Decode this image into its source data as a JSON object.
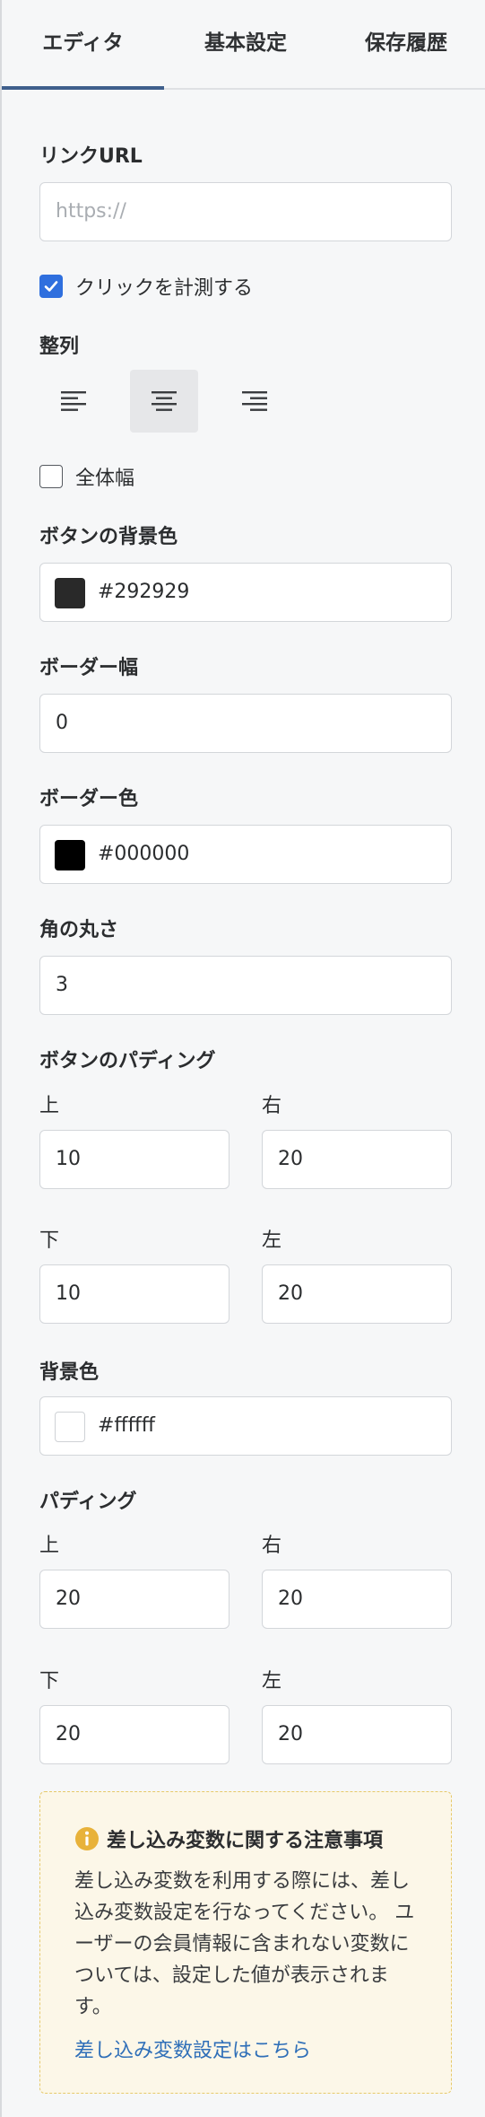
{
  "tabs": [
    "エディタ",
    "基本設定",
    "保存履歴"
  ],
  "link": {
    "label": "リンクURL",
    "placeholder": "https://",
    "value": ""
  },
  "track_click": {
    "label": "クリックを計測する",
    "checked": true
  },
  "align": {
    "label": "整列",
    "options": [
      "left",
      "center",
      "right"
    ],
    "selected": "center"
  },
  "full_width": {
    "label": "全体幅",
    "checked": false
  },
  "button_bg": {
    "label": "ボタンの背景色",
    "value": "#292929",
    "color": "#292929"
  },
  "border_width": {
    "label": "ボーダー幅",
    "value": "0"
  },
  "border_color": {
    "label": "ボーダー色",
    "value": "#000000",
    "color": "#000000"
  },
  "radius": {
    "label": "角の丸さ",
    "value": "3"
  },
  "button_padding": {
    "label": "ボタンのパディング",
    "top_label": "上",
    "top": "10",
    "right_label": "右",
    "right": "20",
    "bottom_label": "下",
    "bottom": "10",
    "left_label": "左",
    "left": "20"
  },
  "background": {
    "label": "背景色",
    "value": "#ffffff",
    "color": "#ffffff"
  },
  "padding": {
    "label": "パディング",
    "top_label": "上",
    "top": "20",
    "right_label": "右",
    "right": "20",
    "bottom_label": "下",
    "bottom": "20",
    "left_label": "左",
    "left": "20"
  },
  "notice": {
    "title": "差し込み変数に関する注意事項",
    "body": "差し込み変数を利用する際には、差し込み変数設定を行なってください。 ユーザーの会員情報に含まれない変数については、設定した値が表示されます。",
    "link": "差し込み変数設定はこちら",
    "icon": "info-icon",
    "accent": "#e8b23a"
  },
  "colors": {
    "tab_active": "#3f5f8c",
    "checkbox": "#2f6fde",
    "link": "#2f6fb8"
  }
}
